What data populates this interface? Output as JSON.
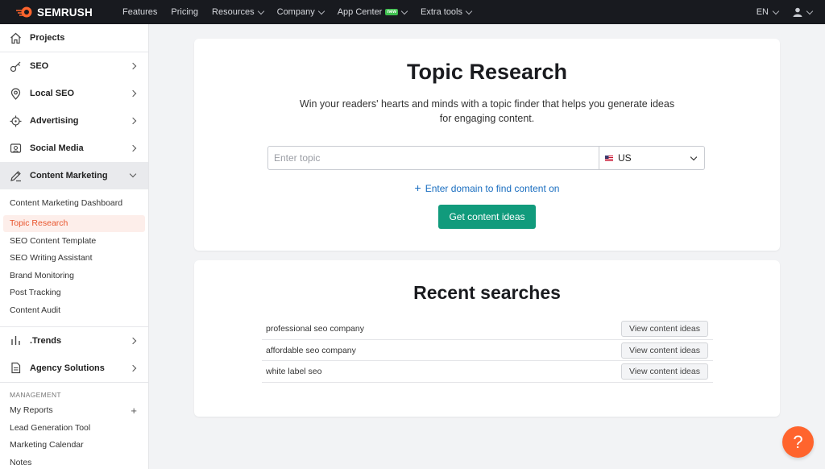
{
  "brand": {
    "name": "SEMRUSH",
    "accent": "#ff642d",
    "primary": "#119b7c"
  },
  "topnav": {
    "items": [
      {
        "label": "Features",
        "dropdown": false
      },
      {
        "label": "Pricing",
        "dropdown": false
      },
      {
        "label": "Resources",
        "dropdown": true
      },
      {
        "label": "Company",
        "dropdown": true
      },
      {
        "label": "App Center",
        "dropdown": true,
        "badge": "new"
      },
      {
        "label": "Extra tools",
        "dropdown": true
      }
    ],
    "lang": "EN"
  },
  "sidebar": {
    "sections": [
      {
        "label": "Projects",
        "icon": "home-icon"
      },
      {
        "label": "SEO",
        "icon": "key-icon"
      },
      {
        "label": "Local SEO",
        "icon": "pin-icon"
      },
      {
        "label": "Advertising",
        "icon": "target-icon"
      },
      {
        "label": "Social Media",
        "icon": "social-icon"
      },
      {
        "label": "Content Marketing",
        "icon": "pen-icon"
      }
    ],
    "content_marketing_items": [
      "Content Marketing Dashboard",
      "Topic Research",
      "SEO Content Template",
      "SEO Writing Assistant",
      "Brand Monitoring",
      "Post Tracking",
      "Content Audit"
    ],
    "active_item": "Topic Research",
    "extra_sections": [
      {
        "label": ".Trends",
        "icon": "bars-icon"
      },
      {
        "label": "Agency Solutions",
        "icon": "doc-icon"
      }
    ],
    "management": {
      "heading": "MANAGEMENT",
      "items": [
        "My Reports",
        "Lead Generation Tool",
        "Marketing Calendar",
        "Notes"
      ]
    }
  },
  "main": {
    "title": "Topic Research",
    "description": "Win your readers' hearts and minds with a topic finder that helps you generate ideas for engaging content.",
    "search": {
      "placeholder": "Enter topic",
      "value": "",
      "country": "US"
    },
    "domain_link": "Enter domain to find content on",
    "cta": "Get content ideas"
  },
  "recent": {
    "title": "Recent searches",
    "button_label": "View content ideas",
    "items": [
      "professional seo company",
      "affordable seo company",
      "white label seo"
    ]
  },
  "help": {
    "label": "?"
  }
}
